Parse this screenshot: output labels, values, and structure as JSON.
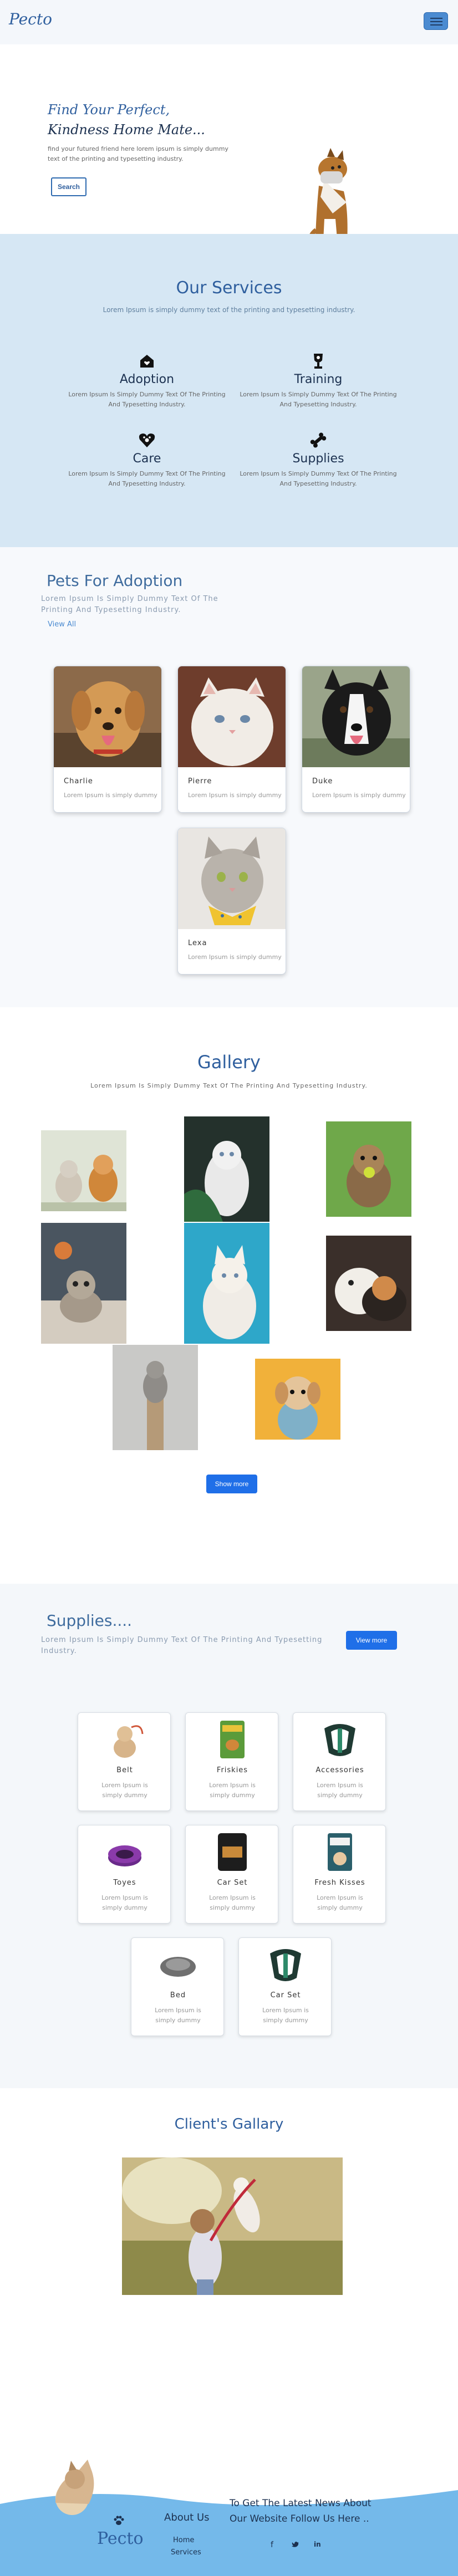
{
  "brand": {
    "name": "Pecto"
  },
  "hero": {
    "title_line1": "Find Your Perfect,",
    "title_line2": "Kindness Home Mate...",
    "text": "find your futured friend here lorem ipsum is simply dummy text of the printing and typesetting industry.",
    "button": "Search"
  },
  "services": {
    "title": "Our Services",
    "subtitle": "Lorem Ipsum is simply dummy text of the printing and typesetting industry.",
    "items": [
      {
        "name": "Adoption",
        "desc": "Lorem Ipsum Is Simply Dummy Text Of The Printing And Typesetting Industry.",
        "icon": "home-heart-icon"
      },
      {
        "name": "Training",
        "desc": "Lorem Ipsum Is Simply Dummy Text Of The Printing And Typesetting Industry.",
        "icon": "trophy-icon"
      },
      {
        "name": "Care",
        "desc": "Lorem Ipsum Is Simply Dummy Text Of The Printing And Typesetting Industry.",
        "icon": "heart-paw-icon"
      },
      {
        "name": "Supplies",
        "desc": "Lorem Ipsum Is Simply Dummy Text Of The Printing And Typesetting Industry.",
        "icon": "bone-icon"
      }
    ]
  },
  "adoption": {
    "title": "Pets For Adoption",
    "text": "Lorem Ipsum Is Simply Dummy Text Of The Printing And Typesetting Industry.",
    "view_all": "View All",
    "pets": [
      {
        "name": "Charlie",
        "desc": "Lorem Ipsum is simply dummy"
      },
      {
        "name": "Pierre",
        "desc": "Lorem Ipsum is simply dummy"
      },
      {
        "name": "Duke",
        "desc": "Lorem Ipsum is simply dummy"
      },
      {
        "name": "Lexa",
        "desc": "Lorem Ipsum is simply dummy"
      }
    ]
  },
  "gallery": {
    "title": "Gallery",
    "subtitle": "Lorem Ipsum Is Simply Dummy Text Of The Printing And Typesetting Industry.",
    "button": "Show more"
  },
  "supplies": {
    "title": "Supplies....",
    "text": "Lorem Ipsum Is Simply Dummy Text Of The Printing And Typesetting Industry.",
    "view_more": "View more",
    "items": [
      {
        "name": "Belt",
        "desc": "Lorem Ipsum is simply dummy"
      },
      {
        "name": "Friskies",
        "desc": "Lorem Ipsum is simply dummy"
      },
      {
        "name": "Accessories",
        "desc": "Lorem Ipsum is simply dummy"
      },
      {
        "name": "Toyes",
        "desc": "Lorem Ipsum is simply dummy"
      },
      {
        "name": "Car Set",
        "desc": "Lorem Ipsum is simply dummy"
      },
      {
        "name": "Fresh Kisses",
        "desc": "Lorem Ipsum is simply dummy"
      },
      {
        "name": "Bed",
        "desc": "Lorem Ipsum is simply dummy"
      },
      {
        "name": "Car Set",
        "desc": "Lorem Ipsum is simply dummy"
      }
    ]
  },
  "clients": {
    "title": "Client's Gallary"
  },
  "footer": {
    "logo": "Pecto",
    "about_title": "About Us",
    "links": [
      "Home",
      "Services"
    ],
    "news_title_line1": "To Get The Latest News About",
    "news_title_line2": "Our Website Follow Us Here ..",
    "social": [
      "facebook-icon",
      "twitter-icon",
      "linkedin-icon"
    ]
  },
  "colors": {
    "brand": "#2f5f9e",
    "accent": "#1f6fe8",
    "services_bg": "#d6e7f4",
    "footer_wave": "#74b9ea"
  }
}
